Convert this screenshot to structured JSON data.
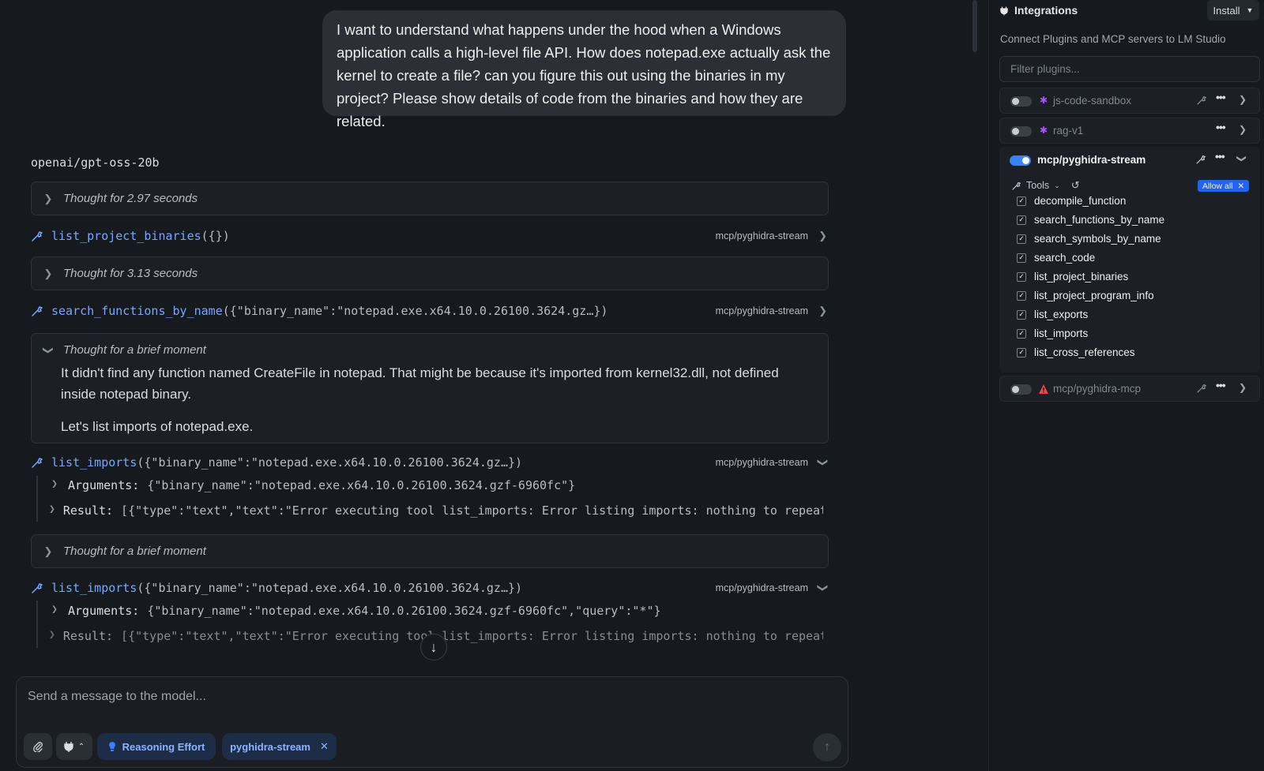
{
  "chat": {
    "user_message": "I want to understand what happens under the hood when a Windows application calls a high-level file API. How does notepad.exe actually ask the kernel to create a file? can you figure this out using the binaries in my project? Please show details of code from the binaries and how they are related.",
    "model_name": "openai/gpt-oss-20b",
    "thought_1": "Thought for 2.97 seconds",
    "tool_1": {
      "name": "list_project_binaries",
      "args": "({})",
      "source": "mcp/pyghidra-stream"
    },
    "thought_2": "Thought for 3.13 seconds",
    "tool_2": {
      "name": "search_functions_by_name",
      "args": "({\"binary_name\":\"notepad.exe.x64.10.0.26100.3624.gz…})",
      "source": "mcp/pyghidra-stream"
    },
    "thought_3": {
      "head": "Thought for a brief moment",
      "para1": "It didn't find any function named CreateFile in notepad. That might be because it's imported from kernel32.dll, not defined inside notepad binary.",
      "para2": "Let's list imports of notepad.exe."
    },
    "tool_3": {
      "name": "list_imports",
      "args": "({\"binary_name\":\"notepad.exe.x64.10.0.26100.3624.gz…})",
      "source": "mcp/pyghidra-stream",
      "arguments_label": "Arguments:",
      "arguments_value": "{\"binary_name\":\"notepad.exe.x64.10.0.26100.3624.gzf-6960fc\"}",
      "result_label": "Result:",
      "result_value": "[{\"type\":\"text\",\"text\":\"Error executing tool list_imports: Error listing imports: nothing to repeat at …"
    },
    "thought_4": "Thought for a brief moment",
    "tool_4": {
      "name": "list_imports",
      "args": "({\"binary_name\":\"notepad.exe.x64.10.0.26100.3624.gz…})",
      "source": "mcp/pyghidra-stream",
      "arguments_label": "Arguments:",
      "arguments_value": "{\"binary_name\":\"notepad.exe.x64.10.0.26100.3624.gzf-6960fc\",\"query\":\"*\"}",
      "result_label": "Result:",
      "result_value": "[{\"type\":\"text\",\"text\":\"Error executing tool list_imports: Error listing imports: nothing to repeat at …"
    }
  },
  "composer": {
    "placeholder": "Send a message to the model...",
    "reasoning_label": "Reasoning Effort",
    "plugin_pill": "pyghidra-stream"
  },
  "panel": {
    "title": "Integrations",
    "install_label": "Install",
    "subtitle": "Connect Plugins and MCP servers to LM Studio",
    "filter_placeholder": "Filter plugins...",
    "plugins": [
      {
        "name": "js-code-sandbox",
        "enabled": false
      },
      {
        "name": "rag-v1",
        "enabled": false
      },
      {
        "name": "mcp/pyghidra-stream",
        "enabled": true
      },
      {
        "name": "mcp/pyghidra-mcp",
        "enabled": false
      }
    ],
    "tools_label": "Tools",
    "allow_all_label": "Allow all",
    "tools": [
      "decompile_function",
      "search_functions_by_name",
      "search_symbols_by_name",
      "search_code",
      "list_project_binaries",
      "list_project_program_info",
      "list_exports",
      "list_imports",
      "list_cross_references"
    ]
  },
  "colors": {
    "accent": "#3b82f6",
    "function_name": "#78a7ff",
    "pill_bg": "#1d2c47",
    "warning": "#ef4444",
    "plugin_icon": "#a855f7"
  }
}
